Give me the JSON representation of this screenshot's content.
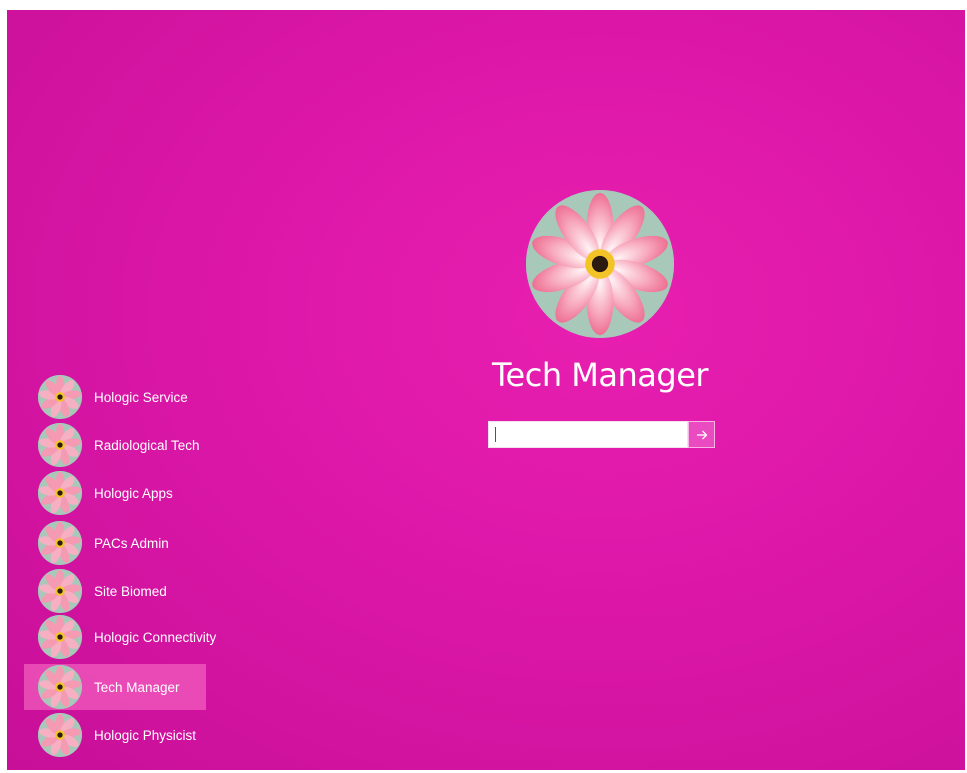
{
  "selected_user": {
    "name": "Tech Manager"
  },
  "password": {
    "value": "",
    "placeholder": ""
  },
  "submit": {
    "icon": "arrow-right-icon"
  },
  "users": [
    {
      "name": "Hologic Service",
      "selected": false
    },
    {
      "name": "Radiological Tech",
      "selected": false
    },
    {
      "name": "Hologic Apps",
      "selected": false
    },
    {
      "name": "PACs Admin",
      "selected": false
    },
    {
      "name": "Site Biomed",
      "selected": false
    },
    {
      "name": "Hologic Connectivity",
      "selected": false
    },
    {
      "name": "Tech Manager",
      "selected": true
    },
    {
      "name": "Hologic Physicist",
      "selected": false
    }
  ],
  "colors": {
    "background": "#dc17a8",
    "selection": "#f278c8",
    "submit_button": "#ea4bc0"
  }
}
